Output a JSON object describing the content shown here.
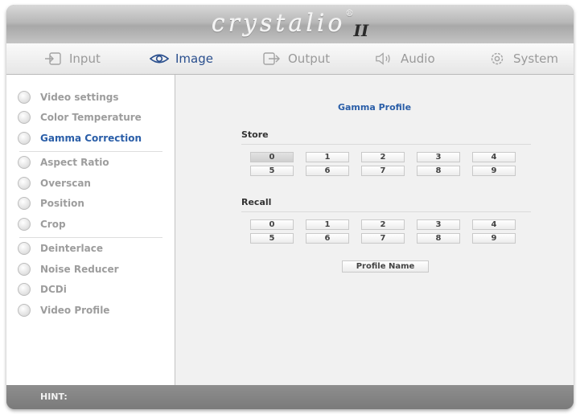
{
  "app": {
    "logo_text": "crystalio",
    "logo_sub": "II",
    "logo_reg": "®"
  },
  "tabs": [
    {
      "label": "Input",
      "icon": "input-icon",
      "active": false
    },
    {
      "label": "Image",
      "icon": "eye-icon",
      "active": true
    },
    {
      "label": "Output",
      "icon": "output-icon",
      "active": false
    },
    {
      "label": "Audio",
      "icon": "speaker-icon",
      "active": false
    },
    {
      "label": "System",
      "icon": "gear-icon",
      "active": false
    }
  ],
  "sidebar": {
    "items": [
      {
        "label": "Video settings"
      },
      {
        "label": "Color Temperature"
      },
      {
        "label": "Gamma Correction",
        "active": true
      },
      {
        "label": "Aspect Ratio"
      },
      {
        "label": "Overscan"
      },
      {
        "label": "Position"
      },
      {
        "label": "Crop"
      },
      {
        "label": "Deinterlace"
      },
      {
        "label": "Noise Reducer"
      },
      {
        "label": "DCDi"
      },
      {
        "label": "Video Profile"
      }
    ]
  },
  "main": {
    "title": "Gamma Profile",
    "store_label": "Store",
    "recall_label": "Recall",
    "store_buttons": [
      "0",
      "1",
      "2",
      "3",
      "4",
      "5",
      "6",
      "7",
      "8",
      "9"
    ],
    "recall_buttons": [
      "0",
      "1",
      "2",
      "3",
      "4",
      "5",
      "6",
      "7",
      "8",
      "9"
    ],
    "store_selected": "0",
    "profile_name_label": "Profile Name"
  },
  "hint": {
    "label": "HINT:"
  },
  "colors": {
    "accent": "#2a5ea8",
    "tab_active": "#2a4f8e",
    "text_muted": "#9d9d9d"
  }
}
